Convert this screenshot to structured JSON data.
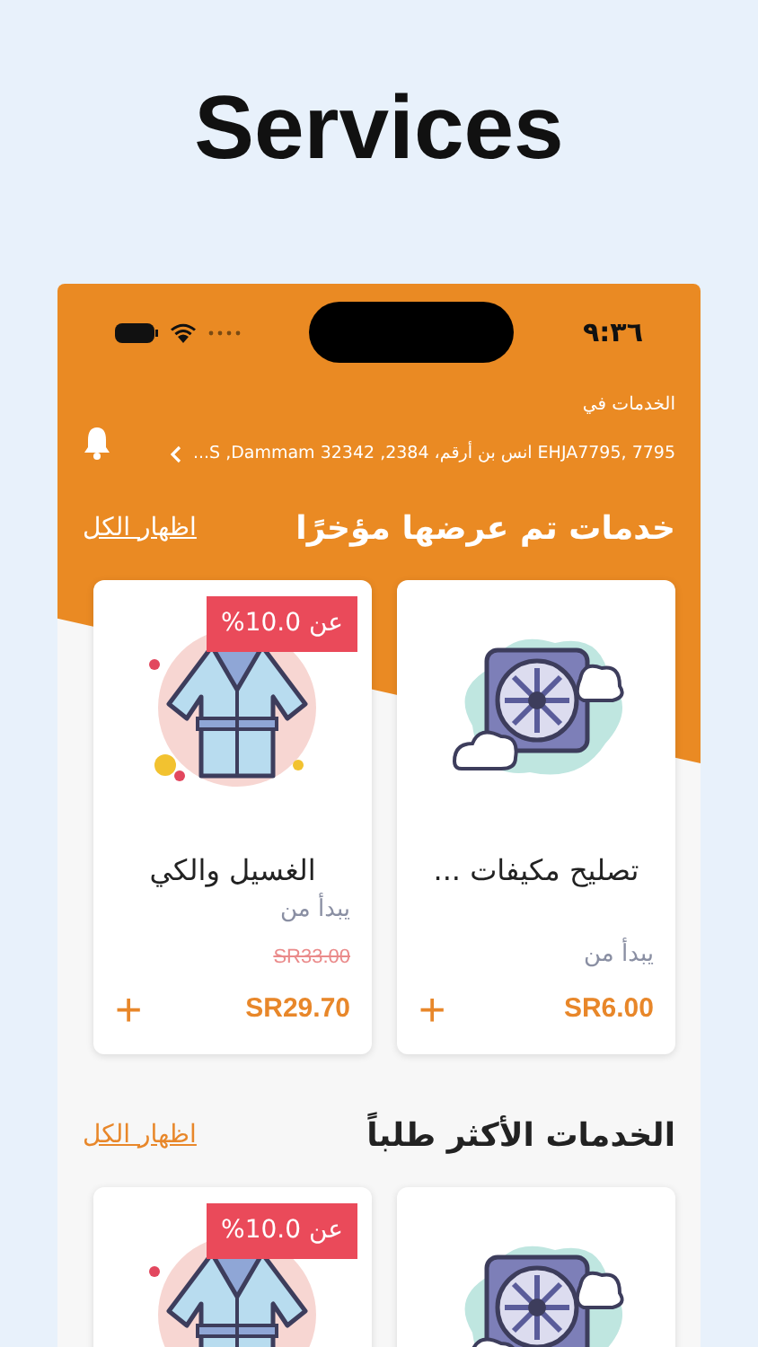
{
  "headline": "Services",
  "status_bar": {
    "time": "٩:٣٦"
  },
  "location": {
    "label": "الخدمات في",
    "address": "7795 ,EHJA7795 انس بن أرقم، 2384, S ,Dammam 32342..."
  },
  "sections": [
    {
      "title": "خدمات تم عرضها مؤخرًا",
      "link": "اظهار الكل",
      "items": [
        {
          "kind": "cooling",
          "name": "تصليح مكيفات ...",
          "from": "يبدأ من",
          "price": "SR6.00",
          "add": "+"
        },
        {
          "kind": "laundry",
          "name": "الغسيل والكي",
          "from": "يبدأ من",
          "old_price": "SR33.00",
          "price": "SR29.70",
          "add": "+",
          "badge": "عن 10.0%"
        }
      ]
    },
    {
      "title": "الخدمات الأكثر طلباً",
      "link": "اظهار الكل",
      "items": [
        {
          "kind": "cooling"
        },
        {
          "kind": "laundry",
          "badge": "عن 10.0%"
        }
      ]
    }
  ]
}
